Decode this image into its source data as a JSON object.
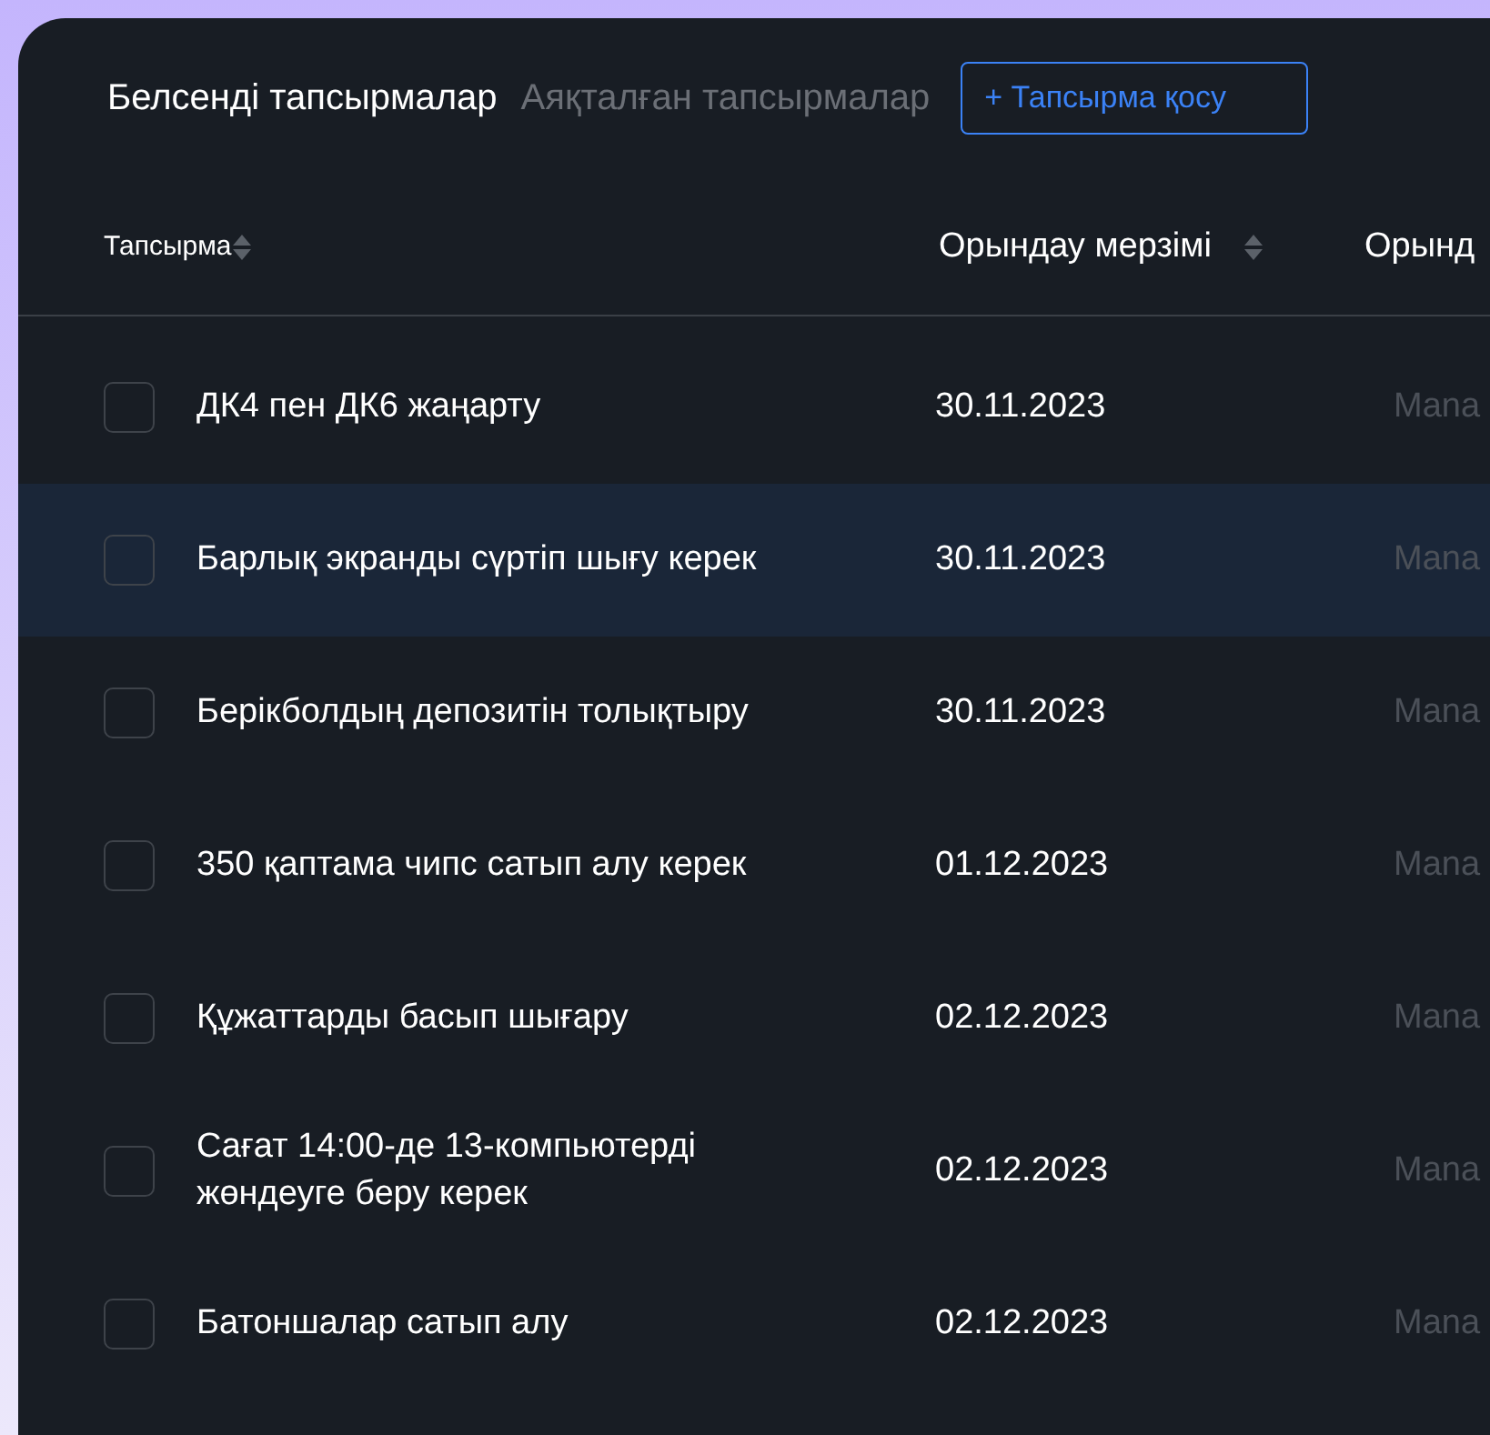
{
  "tabs": [
    {
      "label": "Белсенді тапсырмалар",
      "selected": true
    },
    {
      "label": "Аяқталған тапсырмалар",
      "selected": false
    }
  ],
  "add_button": "+ Тапсырма қосу",
  "table": {
    "columns": [
      {
        "label": "Тапсырма",
        "sortable": true
      },
      {
        "label": "Орындау мерзімі",
        "sortable": true
      },
      {
        "label": "Орынд",
        "sortable": false
      }
    ],
    "rows": [
      {
        "task": "ДК4 пен ДК6 жаңарту",
        "due": "30.11.2023",
        "column_3": "Mana",
        "checked": false,
        "selected": false
      },
      {
        "task": "Барлық экранды сүртіп шығу керек",
        "due": "30.11.2023",
        "column_3": "Mana",
        "checked": false,
        "selected": true
      },
      {
        "task": "Берікболдың депозитін толықтыру",
        "due": "30.11.2023",
        "column_3": "Mana",
        "checked": false,
        "selected": false
      },
      {
        "task": "350 қаптама чипс сатып алу керек",
        "due": "01.12.2023",
        "column_3": "Mana",
        "checked": false,
        "selected": false
      },
      {
        "task": "Құжаттарды басып шығару",
        "due": "02.12.2023",
        "column_3": "Mana",
        "checked": false,
        "selected": false
      },
      {
        "task": "Сағат 14:00-де 13-компьютерді жөндеуге беру керек",
        "due": "02.12.2023",
        "column_3": "Mana",
        "checked": false,
        "selected": false
      },
      {
        "task": "Батоншалар сатып алу",
        "due": "02.12.2023",
        "column_3": "Mana",
        "checked": false,
        "selected": false
      }
    ]
  }
}
